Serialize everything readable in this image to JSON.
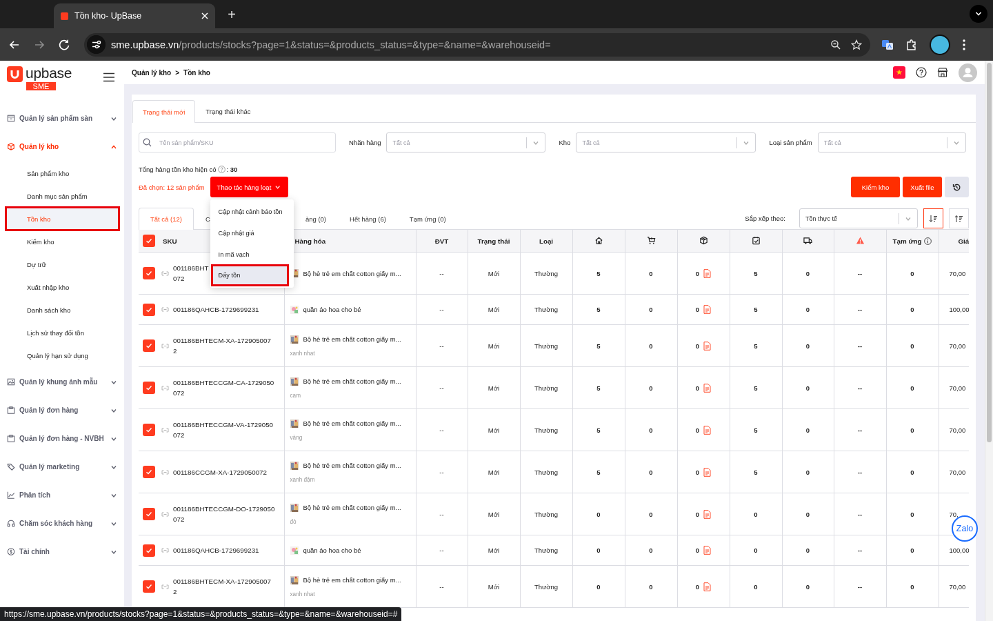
{
  "browser": {
    "tab_title": "Tồn kho- UpBase",
    "new_tab": "+",
    "url_host": "sme.upbase.vn",
    "url_path": "/products/stocks?page=1&status=&products_status=&type=&name=&warehouseid="
  },
  "logo": {
    "name": "upbase",
    "badge": "SME"
  },
  "sidebar": {
    "items": [
      {
        "label": "Quản lý sản phẩm sàn",
        "expanded": false,
        "selected": false
      },
      {
        "label": "Quản lý kho",
        "expanded": true,
        "selected": true,
        "children": [
          {
            "label": "Sản phẩm kho",
            "selected": false,
            "highlighted": false
          },
          {
            "label": "Danh mục sản phẩm",
            "selected": false,
            "highlighted": false
          },
          {
            "label": "Tồn kho",
            "selected": true,
            "highlighted": true
          },
          {
            "label": "Kiểm kho",
            "selected": false,
            "highlighted": false
          },
          {
            "label": "Dự trữ",
            "selected": false,
            "highlighted": false
          },
          {
            "label": "Xuất nhập kho",
            "selected": false,
            "highlighted": false
          },
          {
            "label": "Danh sách kho",
            "selected": false,
            "highlighted": false
          },
          {
            "label": "Lịch sử thay đổi tồn",
            "selected": false,
            "highlighted": false
          },
          {
            "label": "Quản lý hạn sử dụng",
            "selected": false,
            "highlighted": false
          }
        ]
      },
      {
        "label": "Quản lý khung ảnh mẫu",
        "expanded": false,
        "selected": false
      },
      {
        "label": "Quản lý đơn hàng",
        "expanded": false,
        "selected": false
      },
      {
        "label": "Quản lý đơn hàng - NVBH",
        "expanded": false,
        "selected": false
      },
      {
        "label": "Quản lý marketing",
        "expanded": false,
        "selected": false
      },
      {
        "label": "Phân tích",
        "expanded": false,
        "selected": false
      },
      {
        "label": "Chăm sóc khách hàng",
        "expanded": false,
        "selected": false
      },
      {
        "label": "Tài chính",
        "expanded": false,
        "selected": false
      }
    ]
  },
  "header": {
    "breadcrumb": [
      "Quản lý kho",
      "Tồn kho"
    ],
    "separator": ">"
  },
  "page_tabs": [
    {
      "label": "Trạng thái mới",
      "selected": true
    },
    {
      "label": "Trạng thái khác",
      "selected": false
    }
  ],
  "filters": {
    "search": {
      "placeholder": "Tên sản phẩm/SKU"
    },
    "selects": [
      {
        "label": "Nhãn hàng",
        "placeholder": "Tất cả"
      },
      {
        "label": "Kho",
        "placeholder": "Tất cả"
      },
      {
        "label": "Loại sản phẩm",
        "placeholder": "Tất cả"
      }
    ]
  },
  "total": {
    "label": "Tổng hàng tồn kho hiện có",
    "value": ": **30**"
  },
  "selection": {
    "text": "Đã chọn: 12 sản phẩm",
    "bulk_button": "Thao tác hàng loạt",
    "menu": [
      {
        "label": "Cập nhật cảnh báo tồn",
        "highlighted": false
      },
      {
        "label": "Cập nhật giá",
        "highlighted": false
      },
      {
        "label": "In mã vạch",
        "highlighted": false
      },
      {
        "label": "Đẩy tồn",
        "highlighted": true
      }
    ]
  },
  "actions": [
    {
      "kind": "text",
      "label": "Kiểm kho"
    },
    {
      "kind": "text",
      "label": "Xuất file"
    },
    {
      "kind": "history"
    }
  ],
  "status_tabs": [
    {
      "label": "Tất cả (12)",
      "selected": true
    },
    {
      "label": "C",
      "selected": false
    },
    {
      "label": "àng (0)",
      "selected": false
    },
    {
      "label": "Hết hàng (6)",
      "selected": false
    },
    {
      "label": "Tạm ứng (0)",
      "selected": false
    }
  ],
  "sort": {
    "label": "Sắp xếp theo:",
    "value": "Tồn thực tế",
    "buttons": [
      {
        "kind": "descending",
        "selected": true
      },
      {
        "kind": "ascending",
        "selected": false
      }
    ]
  },
  "table": {
    "all_checked": true,
    "columns": [
      {
        "kind": "checkbox",
        "label": "SKU"
      },
      {
        "kind": "text",
        "label": "Hàng hóa"
      },
      {
        "kind": "text",
        "label": "ĐVT"
      },
      {
        "kind": "text",
        "label": "Trạng thái"
      },
      {
        "kind": "text",
        "label": "Loại"
      },
      {
        "kind": "icon"
      },
      {
        "kind": "icon"
      },
      {
        "kind": "icon"
      },
      {
        "kind": "icon"
      },
      {
        "kind": "icon"
      },
      {
        "kind": "icon"
      },
      {
        "kind": "info",
        "label": "Tạm ứng"
      },
      {
        "kind": "text",
        "label": "Giá"
      }
    ],
    "rows": [
      {
        "checked": true,
        "sku": [
          "001186BHT",
          "072"
        ],
        "name": "Bộ hè trẻ em chất cotton giấy m...",
        "unit": "--",
        "status": "Mới",
        "type": "Thường",
        "stock": [
          "5",
          "0",
          "0",
          "5",
          "0",
          "--",
          "0"
        ],
        "price": "70,00"
      },
      {
        "checked": true,
        "sku": [
          "001186QAHCB-1729699231"
        ],
        "name": "quần áo hoa cho bé",
        "unit": "--",
        "status": "Mới",
        "type": "Thường",
        "stock": [
          "5",
          "0",
          "0",
          "5",
          "0",
          "--",
          "0"
        ],
        "price": "100,00"
      },
      {
        "checked": true,
        "sku": [
          "001186BHTECM-XA-172905007",
          "2"
        ],
        "name": "Bộ hè trẻ em chất cotton giấy m...",
        "variant": "xanh nhat",
        "unit": "--",
        "status": "Mới",
        "type": "Thường",
        "stock": [
          "5",
          "0",
          "0",
          "5",
          "0",
          "--",
          "0"
        ],
        "price": "70,00"
      },
      {
        "checked": true,
        "sku": [
          "001186BHTECCGM-CA-1729050",
          "072"
        ],
        "name": "Bộ hè trẻ em chất cotton giấy m...",
        "variant": "cam",
        "unit": "--",
        "status": "Mới",
        "type": "Thường",
        "stock": [
          "5",
          "0",
          "0",
          "5",
          "0",
          "--",
          "0"
        ],
        "price": "70,00"
      },
      {
        "checked": true,
        "sku": [
          "001186BHTECCGM-VA-1729050",
          "072"
        ],
        "name": "Bộ hè trẻ em chất cotton giấy m...",
        "variant": "vàng",
        "unit": "--",
        "status": "Mới",
        "type": "Thường",
        "stock": [
          "5",
          "0",
          "0",
          "5",
          "0",
          "--",
          "0"
        ],
        "price": "70,00"
      },
      {
        "checked": true,
        "sku": [
          "001186CCGM-XA-1729050072"
        ],
        "name": "Bộ hè trẻ em chất cotton giấy m...",
        "variant": "xanh đậm",
        "unit": "--",
        "status": "Mới",
        "type": "Thường",
        "stock": [
          "5",
          "0",
          "0",
          "5",
          "0",
          "--",
          "0"
        ],
        "price": "70,00"
      },
      {
        "checked": true,
        "sku": [
          "001186BHTECCGM-DO-1729050",
          "072"
        ],
        "name": "Bộ hè trẻ em chất cotton giấy m...",
        "variant": "đỏ",
        "unit": "--",
        "status": "Mới",
        "type": "Thường",
        "stock": [
          "0",
          "0",
          "0",
          "0",
          "0",
          "--",
          "0"
        ],
        "price": "70,"
      },
      {
        "checked": true,
        "sku": [
          "001186QAHCB-1729699231"
        ],
        "name": "quần áo hoa cho bé",
        "unit": "--",
        "status": "Mới",
        "type": "Thường",
        "stock": [
          "0",
          "0",
          "0",
          "0",
          "0",
          "--",
          "0"
        ],
        "price": "100,00"
      },
      {
        "checked": true,
        "sku": [
          "001186BHTECM-XA-172905007",
          "2"
        ],
        "name": "Bộ hè trẻ em chất cotton giấy m...",
        "variant": "xanh nhat",
        "unit": "--",
        "status": "Mới",
        "type": "Thường",
        "stock": [
          "0",
          "0",
          "0",
          "0",
          "0",
          "--",
          "0"
        ],
        "price": "70,00"
      }
    ]
  },
  "chat_button": "Zalo",
  "status_url": "https://sme.upbase.vn/products/stocks?page=1&status=&products_status=&type=&name=&warehouseid=#"
}
